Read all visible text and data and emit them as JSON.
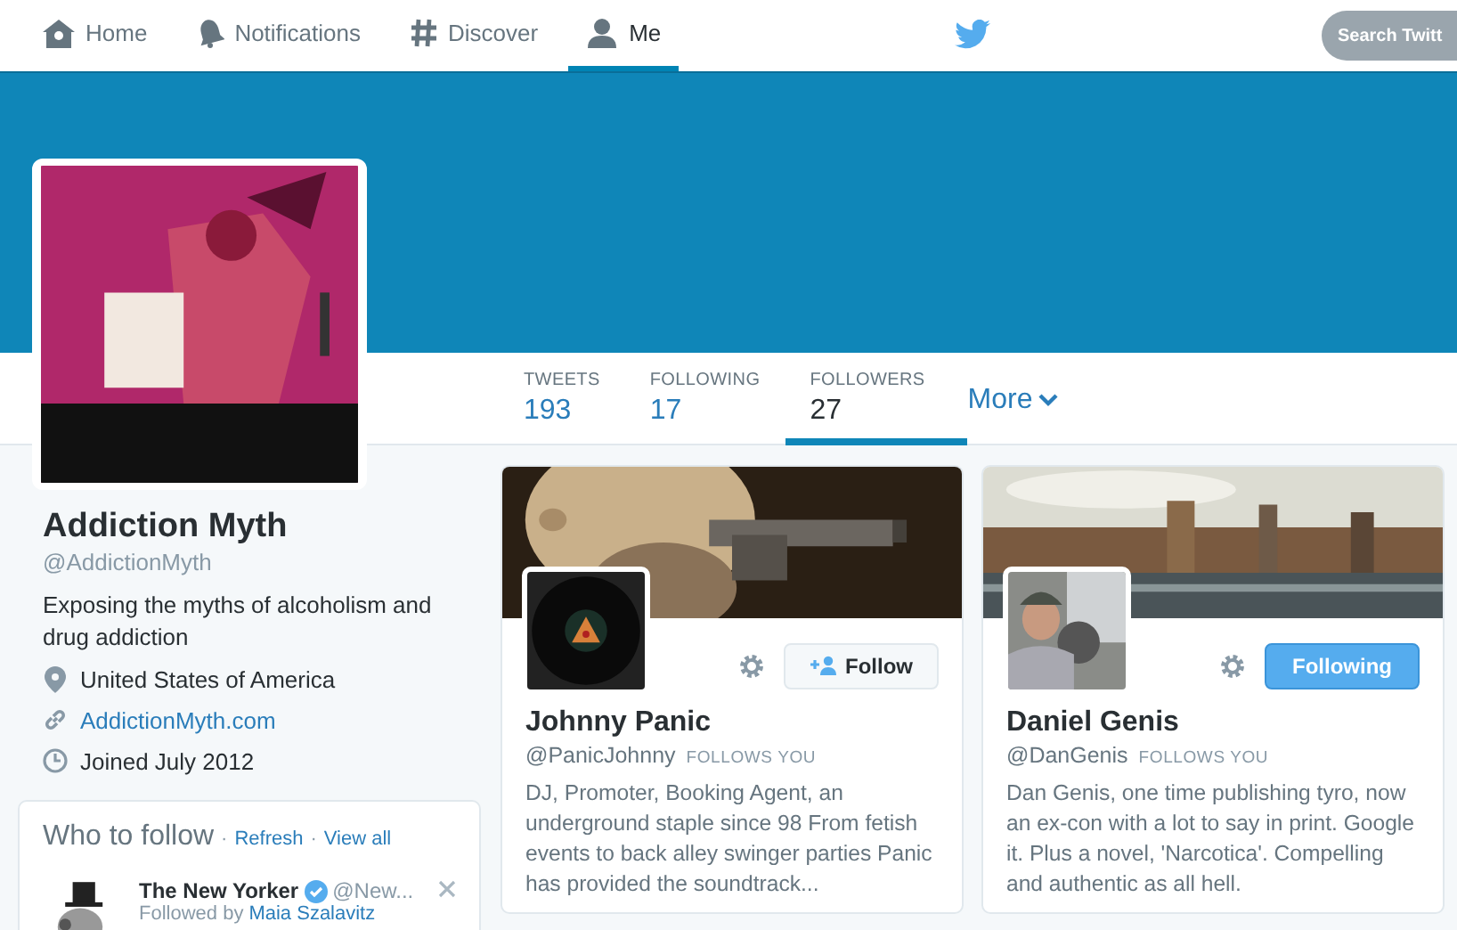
{
  "nav": {
    "items": [
      {
        "label": "Home",
        "selected": false
      },
      {
        "label": "Notifications",
        "selected": false
      },
      {
        "label": "Discover",
        "selected": false
      },
      {
        "label": "Me",
        "selected": true
      }
    ],
    "search": {
      "placeholder": "Search Twitt"
    }
  },
  "profile": {
    "name": "Addiction Myth",
    "handle": "@AddictionMyth",
    "bio": "Exposing the myths of alcoholism and drug addiction",
    "details": [
      {
        "kind": "location",
        "text": "United States of America"
      },
      {
        "kind": "link",
        "text": "AddictionMyth.com"
      },
      {
        "kind": "joined",
        "text": "Joined July 2012"
      }
    ],
    "stats": [
      {
        "label": "TWEETS",
        "value": "193",
        "selected": false
      },
      {
        "label": "FOLLOWING",
        "value": "17",
        "selected": false
      },
      {
        "label": "FOLLOWERS",
        "value": "27",
        "selected": true
      }
    ],
    "more": "More"
  },
  "who_to_follow": {
    "title": "Who to follow",
    "separator": "·",
    "links": [
      "Refresh",
      "View all"
    ],
    "suggestion": {
      "name": "The New Yorker",
      "verified": true,
      "handle": "@New...",
      "followed_by": "Followed by",
      "friend": "Maia Szalavitz"
    }
  },
  "cards": [
    {
      "name": "Johnny Panic",
      "handle": "@PanicJohnny",
      "follows_you": "FOLLOWS YOU",
      "bio": "DJ, Promoter, Booking Agent, an underground staple since 98 From fetish events to back alley swinger parties Panic has provided the soundtrack...",
      "button": "Follow",
      "following": false
    },
    {
      "name": "Daniel Genis",
      "handle": "@DanGenis",
      "follows_you": "FOLLOWS YOU",
      "bio": "Dan Genis, one time publishing tyro, now an ex-con with a lot to say in print. Google it. Plus a novel, 'Narcotica'. Compelling and authentic as all hell.",
      "button": "Following",
      "following": true
    }
  ]
}
